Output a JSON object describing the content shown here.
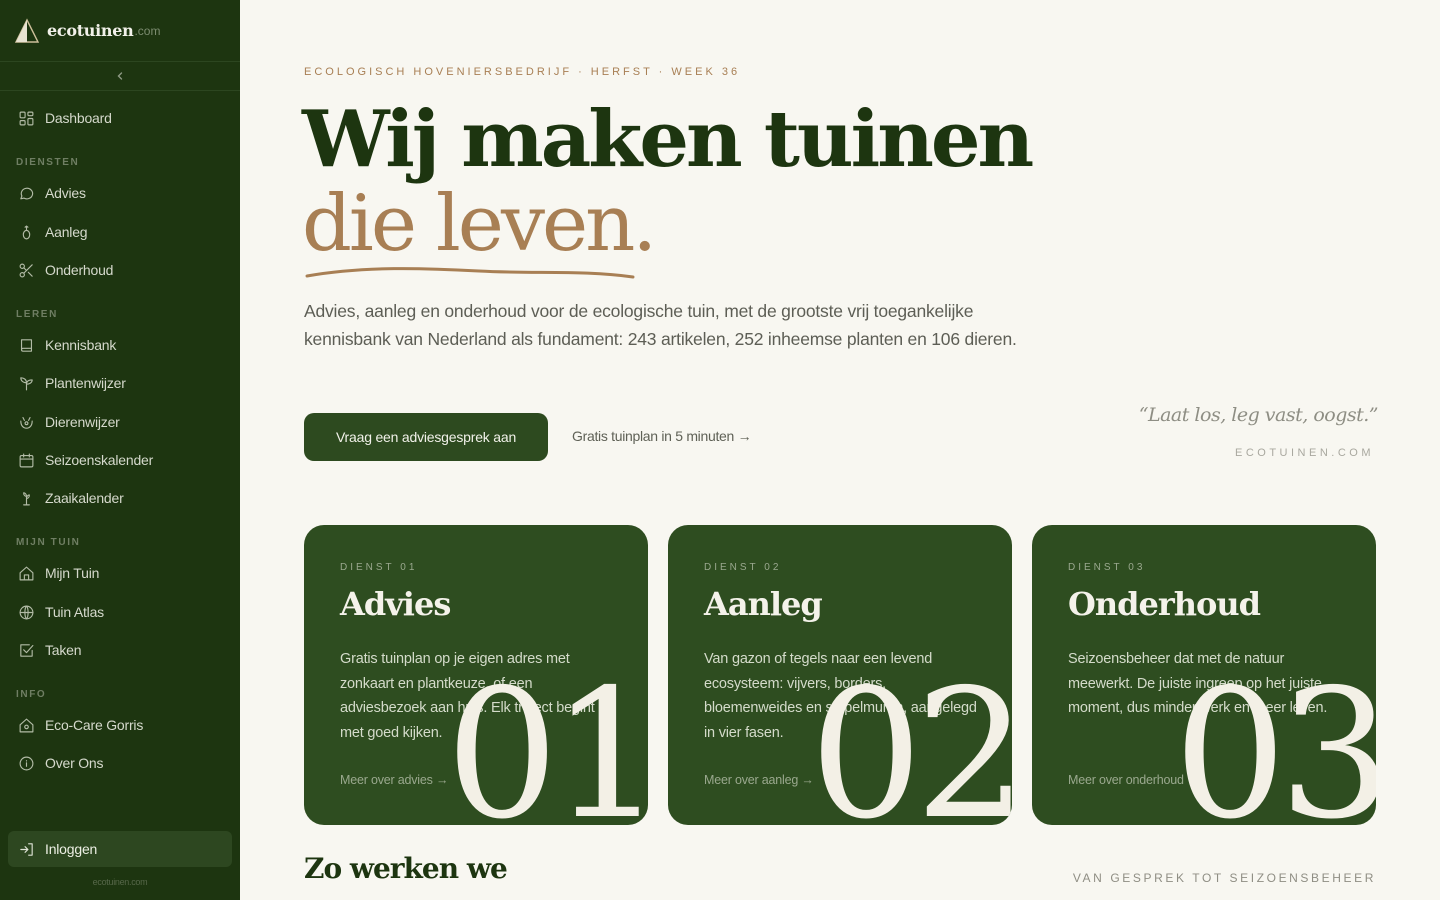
{
  "brand": {
    "name": "ecotuinen",
    "tld": ".com"
  },
  "sidebar": {
    "collapse_icon": "chevron-left-icon",
    "dashboard": {
      "label": "Dashboard",
      "icon": "grid-icon"
    },
    "sections": [
      {
        "heading": "DIENSTEN",
        "items": [
          {
            "label": "Advies",
            "icon": "chat-icon"
          },
          {
            "label": "Aanleg",
            "icon": "seed-icon"
          },
          {
            "label": "Onderhoud",
            "icon": "scissors-icon"
          }
        ]
      },
      {
        "heading": "LEREN",
        "items": [
          {
            "label": "Kennisbank",
            "icon": "book-icon"
          },
          {
            "label": "Plantenwijzer",
            "icon": "sprout-icon"
          },
          {
            "label": "Dierenwijzer",
            "icon": "animal-icon"
          },
          {
            "label": "Seizoenskalender",
            "icon": "calendar-icon"
          },
          {
            "label": "Zaaikalender",
            "icon": "plant-icon"
          }
        ]
      },
      {
        "heading": "MIJN TUIN",
        "items": [
          {
            "label": "Mijn Tuin",
            "icon": "home-icon"
          },
          {
            "label": "Tuin Atlas",
            "icon": "globe-icon"
          },
          {
            "label": "Taken",
            "icon": "checkbox-icon"
          }
        ]
      },
      {
        "heading": "INFO",
        "items": [
          {
            "label": "Eco-Care Gorris",
            "icon": "house-shield-icon"
          },
          {
            "label": "Over Ons",
            "icon": "info-icon"
          }
        ]
      }
    ],
    "login": {
      "label": "Inloggen",
      "icon": "login-icon"
    },
    "footer": "ecotuinen.com"
  },
  "hero": {
    "eyebrow": "ECOLOGISCH HOVENIERSBEDRIJF · HERFST · WEEK 36",
    "title_line1": "Wij maken tuinen",
    "title_line2": "die leven.",
    "intro": "Advies, aanleg en onderhoud voor de ecologische tuin, met de grootste vrij toegankelijke kennisbank van Nederland als fundament: 243 artikelen, 252 inheemse planten en 106 dieren.",
    "cta": "Vraag een adviesgesprek aan",
    "secondary": "Gratis tuinplan in 5 minuten →",
    "quote": "“Laat los, leg vast, oogst.”",
    "quote_source": "ECOTUINEN.COM"
  },
  "cards": [
    {
      "eyebrow": "DIENST 01",
      "title": "Advies",
      "text": "Gratis tuinplan op je eigen adres met zonkaart en plantkeuze, of een adviesbezoek aan huis. Elk traject begint met goed kijken.",
      "link": "Meer over advies →",
      "number": "01"
    },
    {
      "eyebrow": "DIENST 02",
      "title": "Aanleg",
      "text": "Van gazon of tegels naar een levend ecosysteem: vijvers, borders, bloemenweides en stapelmuren, aangelegd in vier fasen.",
      "link": "Meer over aanleg →",
      "number": "02"
    },
    {
      "eyebrow": "DIENST 03",
      "title": "Onderhoud",
      "text": "Seizoensbeheer dat met de natuur meewerkt. De juiste ingreep op het juiste moment, dus minder werk en meer leven.",
      "link": "Meer over onderhoud →",
      "number": "03"
    }
  ],
  "process": {
    "title": "Zo werken we",
    "subtitle": "VAN GESPREK TOT SEIZOENSBEHEER"
  },
  "colors": {
    "sidebar": "#1d3510",
    "accent": "#a87f54",
    "card": "#2e4d20",
    "background": "#f8f7f1"
  }
}
